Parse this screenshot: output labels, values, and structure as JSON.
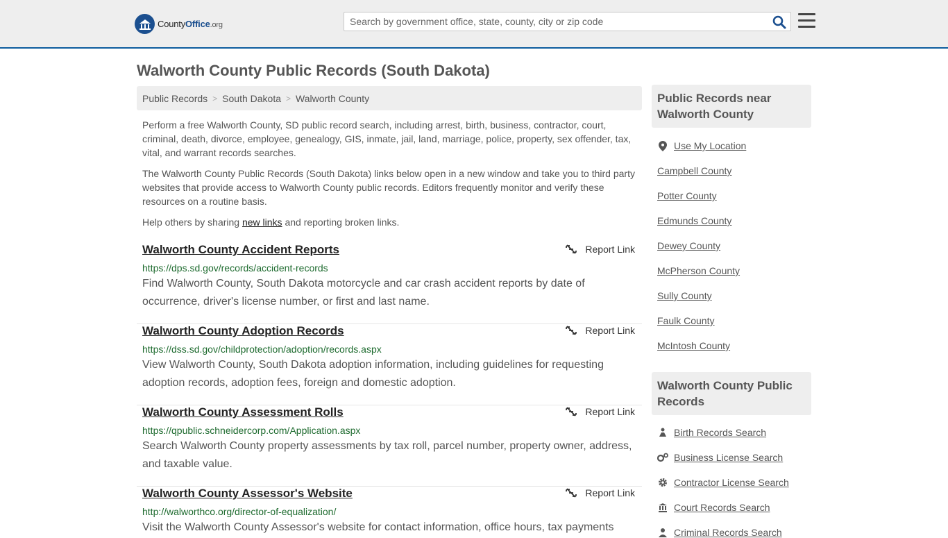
{
  "header": {
    "logo_brand": "County",
    "logo_mid": "Office",
    "logo_tld": ".org",
    "search_placeholder": "Search by government office, state, county, city or zip code"
  },
  "page": {
    "title": "Walworth County Public Records (South Dakota)"
  },
  "breadcrumb": [
    "Public Records",
    "South Dakota",
    "Walworth County"
  ],
  "intro": {
    "p1": "Perform a free Walworth County, SD public record search, including arrest, birth, business, contractor, court, criminal, death, divorce, employee, genealogy, GIS, inmate, jail, land, marriage, police, property, sex offender, tax, vital, and warrant records searches.",
    "p2": "The Walworth County Public Records (South Dakota) links below open in a new window and take you to third party websites that provide access to Walworth County public records. Editors frequently monitor and verify these resources on a routine basis.",
    "p3_before": "Help others by sharing ",
    "p3_link": "new links",
    "p3_after": " and reporting broken links."
  },
  "report_label": "Report Link",
  "records": [
    {
      "title": "Walworth County Accident Reports",
      "url": "https://dps.sd.gov/records/accident-records",
      "desc": "Find Walworth County, South Dakota motorcycle and car crash accident reports by date of occurrence, driver's license number, or first and last name."
    },
    {
      "title": "Walworth County Adoption Records",
      "url": "https://dss.sd.gov/childprotection/adoption/records.aspx",
      "desc": "View Walworth County, South Dakota adoption information, including guidelines for requesting adoption records, adoption fees, foreign and domestic adoption."
    },
    {
      "title": "Walworth County Assessment Rolls",
      "url": "https://qpublic.schneidercorp.com/Application.aspx",
      "desc": "Search Walworth County property assessments by tax roll, parcel number, property owner, address, and taxable value."
    },
    {
      "title": "Walworth County Assessor's Website",
      "url": "http://walworthco.org/director-of-equalization/",
      "desc": "Visit the Walworth County Assessor's website for contact information, office hours, tax payments and"
    }
  ],
  "sidebar": {
    "nearby_title": "Public Records near Walworth County",
    "use_location": "Use My Location",
    "nearby": [
      "Campbell County",
      "Potter County",
      "Edmunds County",
      "Dewey County",
      "McPherson County",
      "Sully County",
      "Faulk County",
      "McIntosh County"
    ],
    "county_title": "Walworth County Public Records",
    "county_links": [
      "Birth Records Search",
      "Business License Search",
      "Contractor License Search",
      "Court Records Search",
      "Criminal Records Search"
    ]
  }
}
